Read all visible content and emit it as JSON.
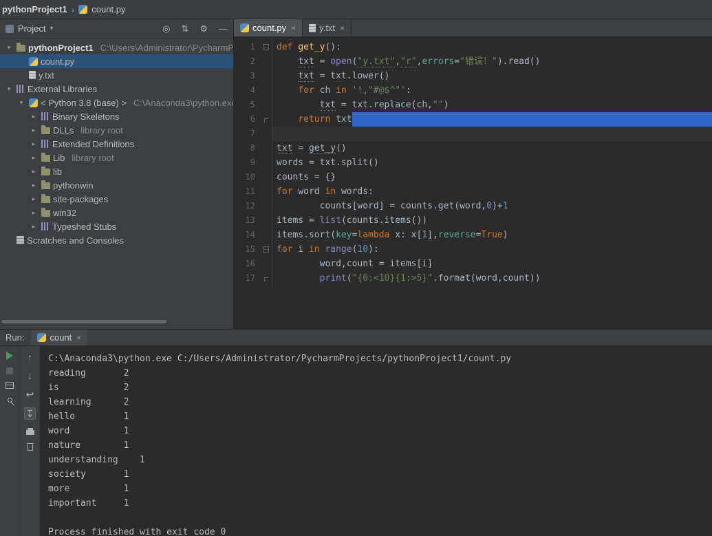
{
  "palette": {
    "bg_editor": "#2b2b2b",
    "bg_panel": "#3c3f41",
    "bg_topbar": "#3b3e40",
    "selection": "#2f65ca",
    "tree_selection": "#2b5278",
    "caret_line": "#323232",
    "tab_active": "#4e5254",
    "keyword": "#cc7832",
    "func": "#ffc66d",
    "string": "#6a8759",
    "number": "#6897bb",
    "builtin": "#8888c6",
    "kwarg": "#56a8a0",
    "plain": "#a9b7c6",
    "line_num": "#606366",
    "tree_text": "#bbbbbb",
    "muted": "#8a8a8a",
    "console_text": "#bcbcbc",
    "run_green": "#499c54",
    "icon": "#afb1b3"
  },
  "icons": {
    "dropdown-arrow": "▾",
    "breadcrumb-separator": "›",
    "locate-icon": "◎",
    "collapse-all-icon": "⇅",
    "gear-icon": "⚙",
    "hide-panel-icon": "—",
    "close-icon": "×",
    "chevron-expanded": "▾",
    "chevron-collapsed": "▸",
    "up-arrow-icon": "↑",
    "down-arrow-icon": "↓",
    "soft-wrap-icon": "↩",
    "scroll-end-icon": "↧"
  },
  "breadcrumb": {
    "project": "pythonProject1",
    "file": "count.py"
  },
  "project_panel": {
    "title": "Project",
    "tree": [
      {
        "depth": 0,
        "icon": "folder",
        "label": "pythonProject1",
        "extra": "C:\\Users\\Administrator\\PycharmP",
        "bold": true,
        "chevron": "v"
      },
      {
        "depth": 1,
        "icon": "py",
        "label": "count.py",
        "selected": true
      },
      {
        "depth": 1,
        "icon": "txt",
        "label": "y.txt"
      },
      {
        "depth": 0,
        "icon": "lib",
        "label": "External Libraries",
        "chevron": "v"
      },
      {
        "depth": 1,
        "icon": "python",
        "label": "< Python 3.8 (base) >",
        "extra": "C:\\Anaconda3\\python.exe",
        "chevron": "v"
      },
      {
        "depth": 2,
        "icon": "lib",
        "label": "Binary Skeletons",
        "chevron": ">"
      },
      {
        "depth": 2,
        "icon": "folder",
        "label": "DLLs",
        "extra": "library root",
        "chevron": ">"
      },
      {
        "depth": 2,
        "icon": "lib",
        "label": "Extended Definitions",
        "chevron": ">"
      },
      {
        "depth": 2,
        "icon": "folder",
        "label": "Lib",
        "extra": "library root",
        "chevron": ">"
      },
      {
        "depth": 2,
        "icon": "folder",
        "label": "lib",
        "chevron": ">"
      },
      {
        "depth": 2,
        "icon": "folder",
        "label": "pythonwin",
        "chevron": ">"
      },
      {
        "depth": 2,
        "icon": "folder",
        "label": "site-packages",
        "chevron": ">"
      },
      {
        "depth": 2,
        "icon": "folder",
        "label": "win32",
        "chevron": ">"
      },
      {
        "depth": 2,
        "icon": "lib",
        "label": "Typeshed Stubs",
        "chevron": ">"
      },
      {
        "depth": 0,
        "icon": "scratch",
        "label": "Scratches and Consoles"
      }
    ]
  },
  "tabs": [
    {
      "label": "count.py",
      "icon": "py",
      "active": true
    },
    {
      "label": "y.txt",
      "icon": "txt",
      "active": false
    }
  ],
  "editor": {
    "lines": [
      {
        "num": "1",
        "fold": "start",
        "tokens": [
          [
            "k",
            "def "
          ],
          [
            "f",
            "get_y"
          ],
          [
            "p",
            "():"
          ]
        ]
      },
      {
        "num": "2",
        "tokens": [
          [
            "p",
            "    "
          ],
          [
            "u",
            "txt"
          ],
          [
            "p",
            " = "
          ],
          [
            "b",
            "open"
          ],
          [
            "p",
            "("
          ],
          [
            "su",
            "\"y.txt\""
          ],
          [
            "p",
            ","
          ],
          [
            "su",
            "\"r\""
          ],
          [
            "p",
            ","
          ],
          [
            "a",
            "errors"
          ],
          [
            "p",
            "="
          ],
          [
            "s",
            "\"错误！\""
          ],
          [
            "p",
            ").read()"
          ]
        ]
      },
      {
        "num": "3",
        "tokens": [
          [
            "p",
            "    "
          ],
          [
            "u",
            "txt"
          ],
          [
            "p",
            " = txt.lower()"
          ]
        ]
      },
      {
        "num": "4",
        "tokens": [
          [
            "p",
            "    "
          ],
          [
            "k",
            "for "
          ],
          [
            "p",
            "ch "
          ],
          [
            "k",
            "in "
          ],
          [
            "s",
            "'!,\"#@$^\"'"
          ],
          [
            "p",
            ":"
          ]
        ]
      },
      {
        "num": "5",
        "tokens": [
          [
            "p",
            "        "
          ],
          [
            "u",
            "txt"
          ],
          [
            "p",
            " = txt.replace(ch,"
          ],
          [
            "s",
            "\"\""
          ],
          [
            "p",
            ")"
          ]
        ]
      },
      {
        "num": "6",
        "fold": "end",
        "sel": true,
        "tokens": [
          [
            "p",
            "    "
          ],
          [
            "k",
            "return "
          ],
          [
            "p",
            "txt"
          ]
        ]
      },
      {
        "num": "7",
        "caret": true,
        "tokens": []
      },
      {
        "num": "8",
        "tokens": [
          [
            "u",
            "txt"
          ],
          [
            "p",
            " = "
          ],
          [
            "u",
            "get_y"
          ],
          [
            "p",
            "()"
          ]
        ]
      },
      {
        "num": "9",
        "tokens": [
          [
            "p",
            "words = txt.split()"
          ]
        ]
      },
      {
        "num": "10",
        "tokens": [
          [
            "p",
            "counts = {}"
          ]
        ]
      },
      {
        "num": "11",
        "tokens": [
          [
            "k",
            "for "
          ],
          [
            "p",
            "word "
          ],
          [
            "k",
            "in "
          ],
          [
            "p",
            "words:"
          ]
        ]
      },
      {
        "num": "12",
        "tokens": [
          [
            "p",
            "        counts[word] = counts.get(word,"
          ],
          [
            "n",
            "0"
          ],
          [
            "p",
            ")+"
          ],
          [
            "n",
            "1"
          ]
        ]
      },
      {
        "num": "13",
        "tokens": [
          [
            "p",
            "items = "
          ],
          [
            "b",
            "list"
          ],
          [
            "p",
            "(counts.items())"
          ]
        ]
      },
      {
        "num": "14",
        "tokens": [
          [
            "p",
            "items.sort("
          ],
          [
            "a",
            "key"
          ],
          [
            "p",
            "="
          ],
          [
            "k",
            "lambda "
          ],
          [
            "p",
            "x: x["
          ],
          [
            "n",
            "1"
          ],
          [
            "p",
            "],"
          ],
          [
            "a",
            "reverse"
          ],
          [
            "p",
            "="
          ],
          [
            "k",
            "True"
          ],
          [
            "p",
            ")"
          ]
        ]
      },
      {
        "num": "15",
        "fold": "start",
        "tokens": [
          [
            "k",
            "for "
          ],
          [
            "p",
            "i "
          ],
          [
            "k",
            "in "
          ],
          [
            "b",
            "range"
          ],
          [
            "p",
            "("
          ],
          [
            "n",
            "10"
          ],
          [
            "p",
            "):"
          ]
        ]
      },
      {
        "num": "16",
        "tokens": [
          [
            "p",
            "        word,count = items[i]"
          ]
        ]
      },
      {
        "num": "17",
        "fold": "end",
        "tokens": [
          [
            "p",
            "        "
          ],
          [
            "b",
            "print"
          ],
          [
            "p",
            "("
          ],
          [
            "s",
            "\"{0:<10}{1:>5}\""
          ],
          [
            "p",
            ".format(word,count))"
          ]
        ]
      }
    ]
  },
  "run_panel": {
    "label": "Run:",
    "tab_label": "count",
    "console": [
      "C:\\Anaconda3\\python.exe C:/Users/Administrator/PycharmProjects/pythonProject1/count.py",
      "reading       2",
      "is            2",
      "learning      2",
      "hello         1",
      "word          1",
      "nature        1",
      "understanding    1",
      "society       1",
      "more          1",
      "important     1",
      "",
      "Process finished with exit code 0"
    ]
  }
}
